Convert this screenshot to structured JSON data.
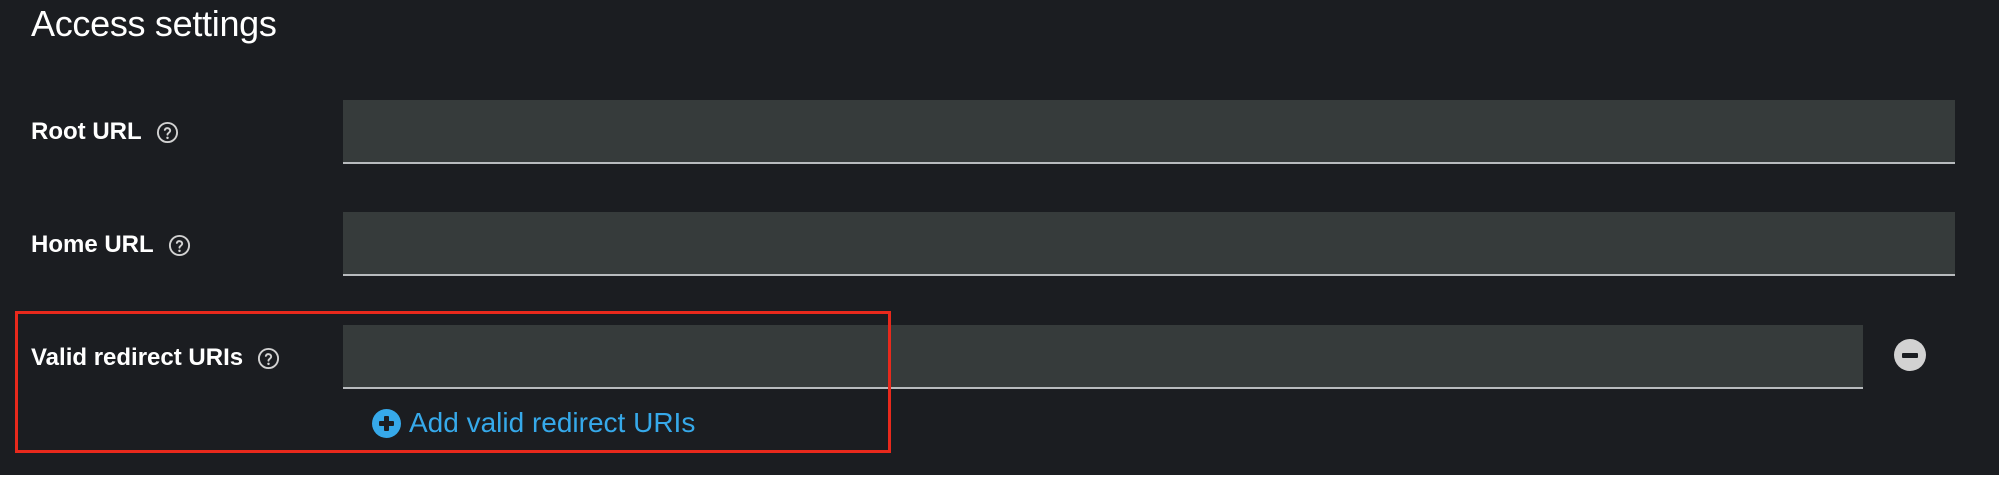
{
  "section": {
    "title": "Access settings"
  },
  "fields": {
    "root_url": {
      "label": "Root URL",
      "value": "",
      "placeholder": ""
    },
    "home_url": {
      "label": "Home URL",
      "value": "",
      "placeholder": ""
    },
    "valid_redirect_uris": {
      "label": "Valid redirect URIs",
      "value": "",
      "placeholder": ""
    }
  },
  "actions": {
    "add_redirect_label": "Add valid redirect URIs"
  },
  "icons": {
    "help": "help-circle-icon",
    "remove": "minus-circle-icon",
    "add": "plus-circle-icon"
  },
  "colors": {
    "background": "#1b1d21",
    "input_background": "#363b3b",
    "link": "#36a9ea",
    "highlight": "#e8291c"
  }
}
